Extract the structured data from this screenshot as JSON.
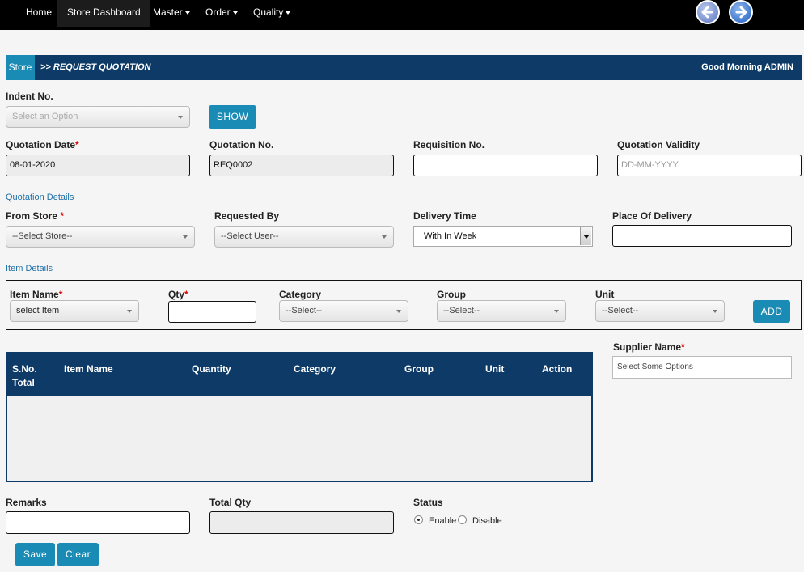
{
  "nav": {
    "items": [
      {
        "label": "Home"
      },
      {
        "label": "Store Dashboard"
      },
      {
        "label": "Master"
      },
      {
        "label": "Order"
      },
      {
        "label": "Quality"
      }
    ]
  },
  "titlebar": {
    "store": "Store",
    "page": ">> REQUEST QUOTATION",
    "greeting": "Good Morning  ADMIN"
  },
  "indent": {
    "label": "Indent No.",
    "placeholder": "Select an Option",
    "show_button": "SHOW"
  },
  "quotation": {
    "date_label": "Quotation Date",
    "date_value": "08-01-2020",
    "no_label": "Quotation No.",
    "no_value": "REQ0002",
    "requisition_label": "Requisition No.",
    "requisition_value": "",
    "validity_label": "Quotation Validity",
    "validity_placeholder": "DD-MM-YYYY"
  },
  "details": {
    "section_title": "Quotation Details",
    "from_store_label": "From Store",
    "from_store_value": "--Select Store--",
    "requested_by_label": "Requested By",
    "requested_by_value": "--Select User--",
    "delivery_time_label": "Delivery Time",
    "delivery_time_value": "With In Week",
    "place_label": "Place Of Delivery",
    "place_value": ""
  },
  "items": {
    "section_title": "Item Details",
    "item_name_label": "Item Name",
    "item_name_value": "select Item",
    "qty_label": "Qty",
    "category_label": "Category",
    "category_value": "--Select--",
    "group_label": "Group",
    "group_value": "--Select--",
    "unit_label": "Unit",
    "unit_value": "--Select--",
    "add_button": "ADD"
  },
  "grid": {
    "columns": [
      "S.No.",
      "Item Name",
      "Quantity",
      "Category",
      "Group",
      "Unit",
      "Action"
    ],
    "footer": "Total"
  },
  "supplier": {
    "label": "Supplier Name",
    "placeholder": "Select Some Options"
  },
  "footer": {
    "remarks_label": "Remarks",
    "total_qty_label": "Total Qty",
    "status_label": "Status",
    "enable_label": "Enable",
    "disable_label": "Disable",
    "status_selected": "Enable",
    "save_button": "Save",
    "clear_button": "Clear"
  },
  "colors": {
    "header_bg": "#0d3a66",
    "accent": "#1a8bb5",
    "required": "#dd0000"
  }
}
